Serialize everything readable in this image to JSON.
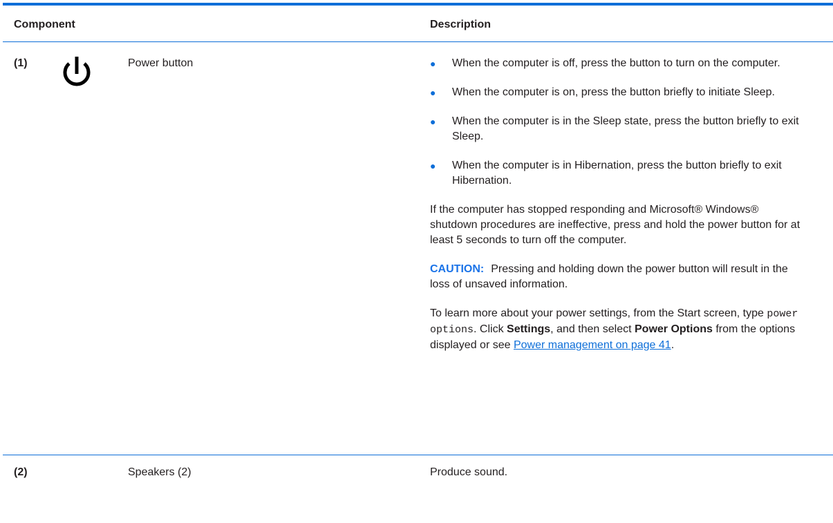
{
  "header": {
    "component": "Component",
    "description": "Description"
  },
  "rows": [
    {
      "number": "(1)",
      "icon": "power-icon",
      "name": "Power button",
      "bullets": [
        "When the computer is off, press the button to turn on the computer.",
        "When the computer is on, press the button briefly to initiate Sleep.",
        "When the computer is in the Sleep state, press the button briefly to exit Sleep.",
        "When the computer is in Hibernation, press the button briefly to exit Hibernation."
      ],
      "paragraph": "If the computer has stopped responding and Microsoft® Windows® shutdown procedures are ineffective, press and hold the power button for at least 5 seconds to turn off the computer.",
      "caution": {
        "label": "CAUTION:",
        "text": "Pressing and holding down the power button will result in the loss of unsaved information."
      },
      "learn_more": {
        "text1": "To learn more about your power settings, from the Start screen, type ",
        "code": "power options",
        "text2": ". Click ",
        "settings": "Settings",
        "text3": ", and then select ",
        "power_options": "Power Options",
        "text4": " from the options displayed or see ",
        "link": "Power management on page 41",
        "text5": "."
      }
    },
    {
      "number": "(2)",
      "name": "Speakers (2)",
      "description": "Produce sound."
    }
  ],
  "colors": {
    "accent": "#0d6ed8",
    "caution": "#1a73e8",
    "text": "#231f20"
  }
}
